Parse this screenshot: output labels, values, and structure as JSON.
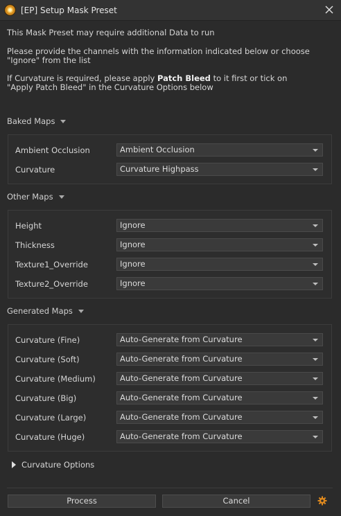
{
  "window": {
    "title": "[EP] Setup Mask Preset"
  },
  "intro": {
    "line1": "This Mask Preset may require additional Data to run",
    "line2a": "Please provide the channels with the information indicated below or choose",
    "line2b": "\"Ignore\" from the list",
    "line3_prefix": "If Curvature is required, please apply ",
    "line3_bold": "Patch Bleed",
    "line3_suffix": " to it first or tick on",
    "line3b": "\"Apply Patch Bleed\" in the Curvature Options below"
  },
  "sections": {
    "baked": {
      "title": "Baked Maps",
      "rows": [
        {
          "label": "Ambient Occlusion",
          "value": "Ambient Occlusion"
        },
        {
          "label": "Curvature",
          "value": "Curvature Highpass"
        }
      ]
    },
    "other": {
      "title": "Other Maps",
      "rows": [
        {
          "label": "Height",
          "value": "Ignore"
        },
        {
          "label": "Thickness",
          "value": "Ignore"
        },
        {
          "label": "Texture1_Override",
          "value": "Ignore"
        },
        {
          "label": "Texture2_Override",
          "value": "Ignore"
        }
      ]
    },
    "generated": {
      "title": "Generated Maps",
      "rows": [
        {
          "label": "Curvature (Fine)",
          "value": "Auto-Generate from Curvature"
        },
        {
          "label": "Curvature (Soft)",
          "value": "Auto-Generate from Curvature"
        },
        {
          "label": "Curvature (Medium)",
          "value": "Auto-Generate from Curvature"
        },
        {
          "label": "Curvature (Big)",
          "value": "Auto-Generate from Curvature"
        },
        {
          "label": "Curvature (Large)",
          "value": "Auto-Generate from Curvature"
        },
        {
          "label": "Curvature (Huge)",
          "value": "Auto-Generate from Curvature"
        }
      ]
    }
  },
  "curvature_options": {
    "label": "Curvature Options"
  },
  "buttons": {
    "process": "Process",
    "cancel": "Cancel"
  },
  "colors": {
    "accent": "#e08a1e",
    "background": "#2b2b2b",
    "field": "#3a3a3a"
  },
  "icons": {
    "app": "painter-logo-icon",
    "close": "close-icon",
    "settings": "gear-icon"
  }
}
